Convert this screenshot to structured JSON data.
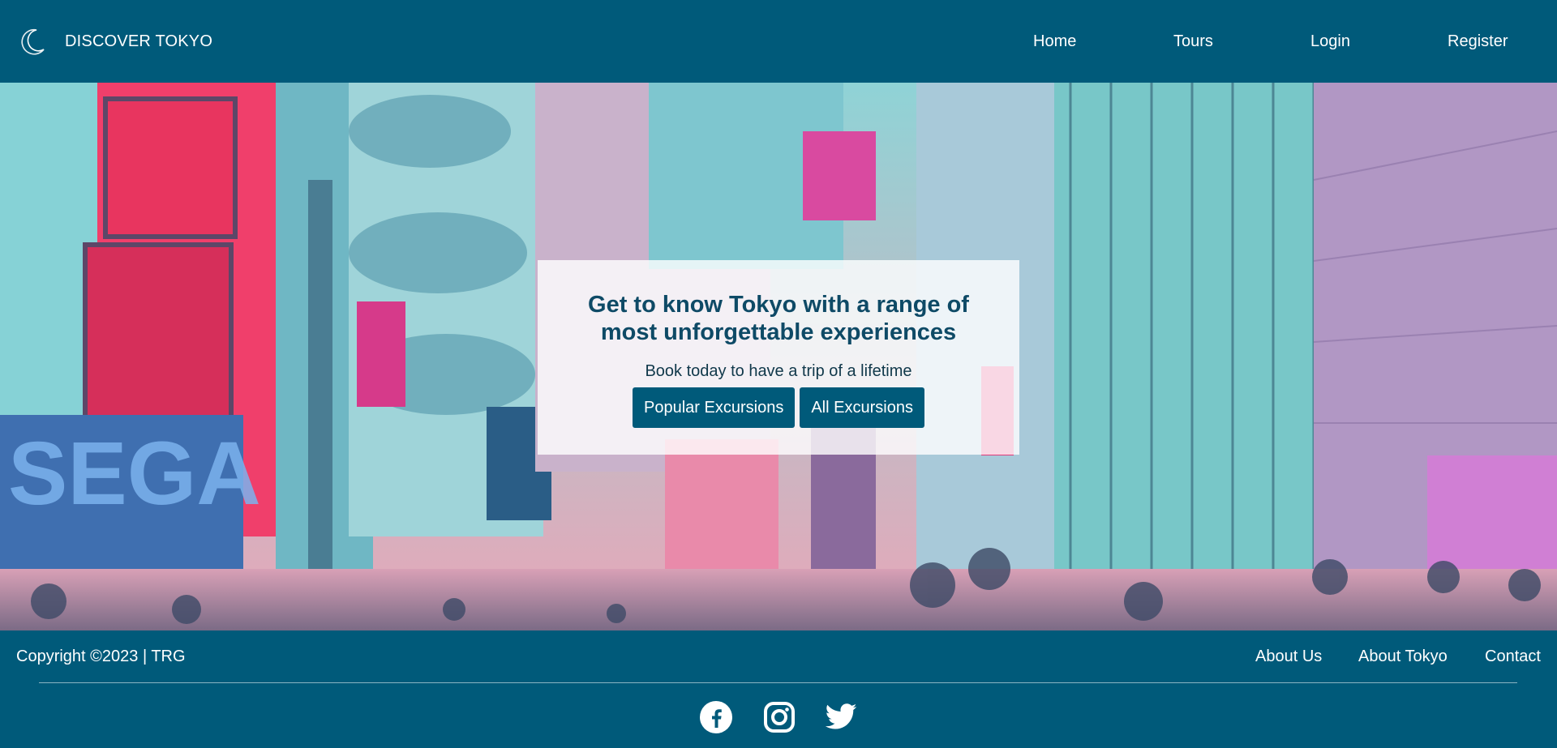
{
  "header": {
    "brand": "DISCOVER TOKYO",
    "logo_icon": "crescent-moon-icon",
    "nav": [
      {
        "label": "Home"
      },
      {
        "label": "Tours"
      },
      {
        "label": "Login"
      },
      {
        "label": "Register"
      }
    ]
  },
  "hero": {
    "title": "Get to know Tokyo with a range of most unforgettable experiences",
    "subtitle": "Book today to have a trip of a lifetime",
    "buttons": [
      {
        "label": "Popular Excursions"
      },
      {
        "label": "All Excursions"
      }
    ],
    "background_image": "tokyo-street-neon-photo"
  },
  "footer": {
    "copyright": "Copyright ©2023 | TRG",
    "links": [
      {
        "label": "About Us"
      },
      {
        "label": "About Tokyo"
      },
      {
        "label": "Contact"
      }
    ],
    "social": [
      {
        "icon": "facebook-icon"
      },
      {
        "icon": "instagram-icon"
      },
      {
        "icon": "twitter-icon"
      }
    ]
  },
  "colors": {
    "primary": "#005a7a",
    "title_text": "#0e4a66",
    "card_background": "rgba(255,255,255,0.80)"
  }
}
